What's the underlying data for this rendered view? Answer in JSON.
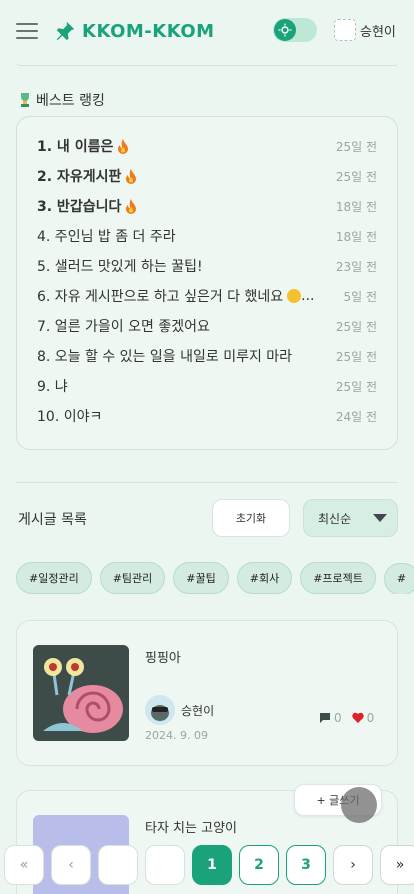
{
  "header": {
    "logo_text": "KKOM-KKOM",
    "user_name": "승현이",
    "brand_color": "#1aa37a"
  },
  "ranking": {
    "title": "베스트 랭킹",
    "items": [
      {
        "title": "1. 내 이름은",
        "date": "25일 전",
        "hot": true
      },
      {
        "title": "2. 자유게시판",
        "date": "25일 전",
        "hot": true
      },
      {
        "title": "3. 반갑습니다",
        "date": "18일 전",
        "hot": true
      },
      {
        "title": "4. 주인님 밥 좀 더 주라",
        "date": "18일 전",
        "hot": false
      },
      {
        "title": "5. 샐러드 맛있게 하는 꿀팁!",
        "date": "23일 전",
        "hot": false
      },
      {
        "title": "6. 자유 게시판으로 하고 싶은거 다 했네요",
        "date": "5일 전",
        "hot": false
      },
      {
        "title": "7. 얼른 가을이 오면 좋겠어요",
        "date": "25일 전",
        "hot": false
      },
      {
        "title": "8. 오늘 할 수 있는 일을 내일로 미루지 마라",
        "date": "25일 전",
        "hot": false
      },
      {
        "title": "9. 냐",
        "date": "25일 전",
        "hot": false
      },
      {
        "title": "10. 이야ㅋ",
        "date": "24일 전",
        "hot": false
      }
    ]
  },
  "post_list": {
    "title": "게시글 목록",
    "reset_label": "초기화",
    "sort_label": "최신순",
    "tags": [
      "#일정관리",
      "#팀관리",
      "#꿀팁",
      "#회사",
      "#프로젝트",
      "#"
    ],
    "posts": [
      {
        "title": "핑핑아",
        "author": "승현이",
        "date": "2024. 9. 09",
        "comments": "0",
        "likes": "0"
      },
      {
        "title": "타자 치는 고양이"
      }
    ],
    "write_label": "+ 글쓰기"
  },
  "pagination": {
    "first": "«",
    "prev": "‹",
    "pages": [
      "1",
      "2",
      "3"
    ],
    "next": "›",
    "last": "»",
    "current": "1"
  }
}
